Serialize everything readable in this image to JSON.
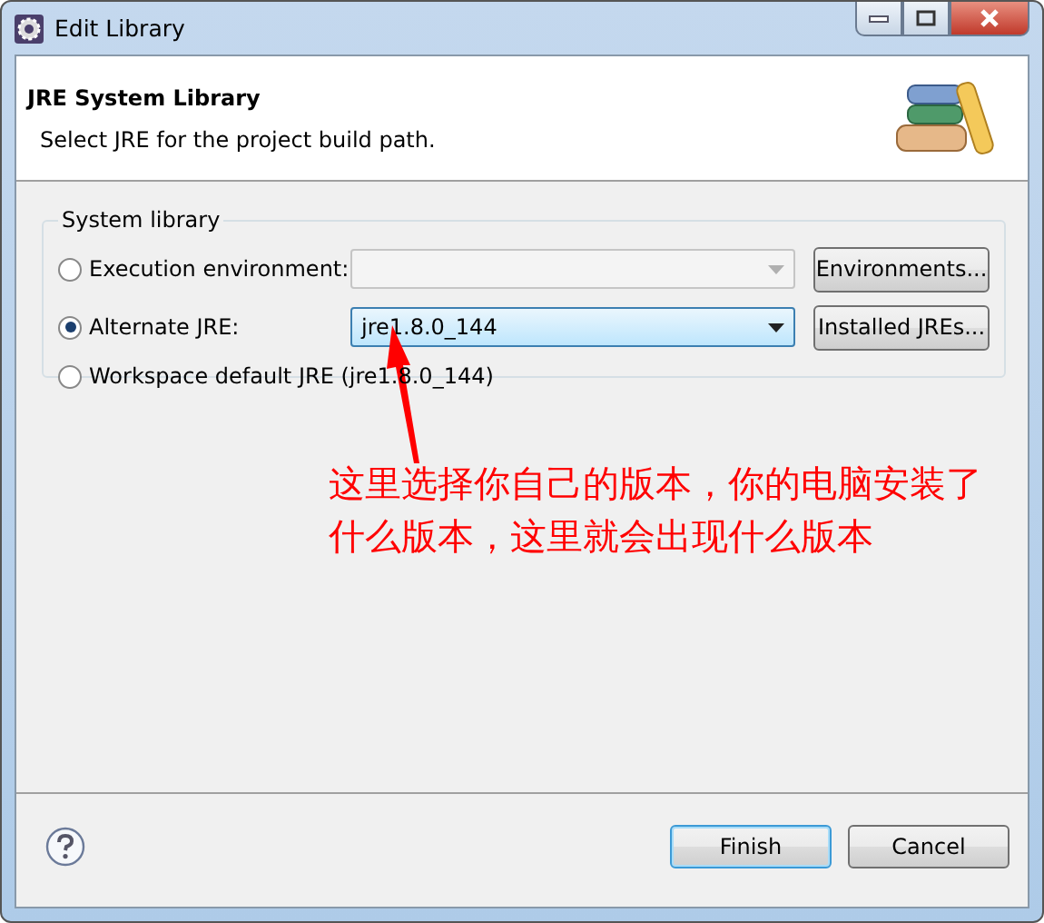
{
  "window": {
    "title": "Edit Library"
  },
  "header": {
    "title": "JRE System Library",
    "description": "Select JRE for the project build path."
  },
  "group": {
    "label": "System library",
    "options": [
      {
        "kind": "combo",
        "label": "Execution environment:",
        "selected": false,
        "disabled": true,
        "button": "Environments..."
      },
      {
        "kind": "combo",
        "label": "Alternate JRE:",
        "selected": true,
        "disabled": false,
        "value": "jre1.8.0_144",
        "button": "Installed JREs..."
      },
      {
        "kind": "plain",
        "label": "Workspace default JRE (jre1.8.0_144)",
        "selected": false
      }
    ]
  },
  "annotation": {
    "text": "这里选择你自己的版本，你的电脑安装了什么版本，这里就会出现什么版本"
  },
  "buttons": [
    {
      "label": "Finish",
      "default": true
    },
    {
      "label": "Cancel",
      "default": false
    }
  ]
}
